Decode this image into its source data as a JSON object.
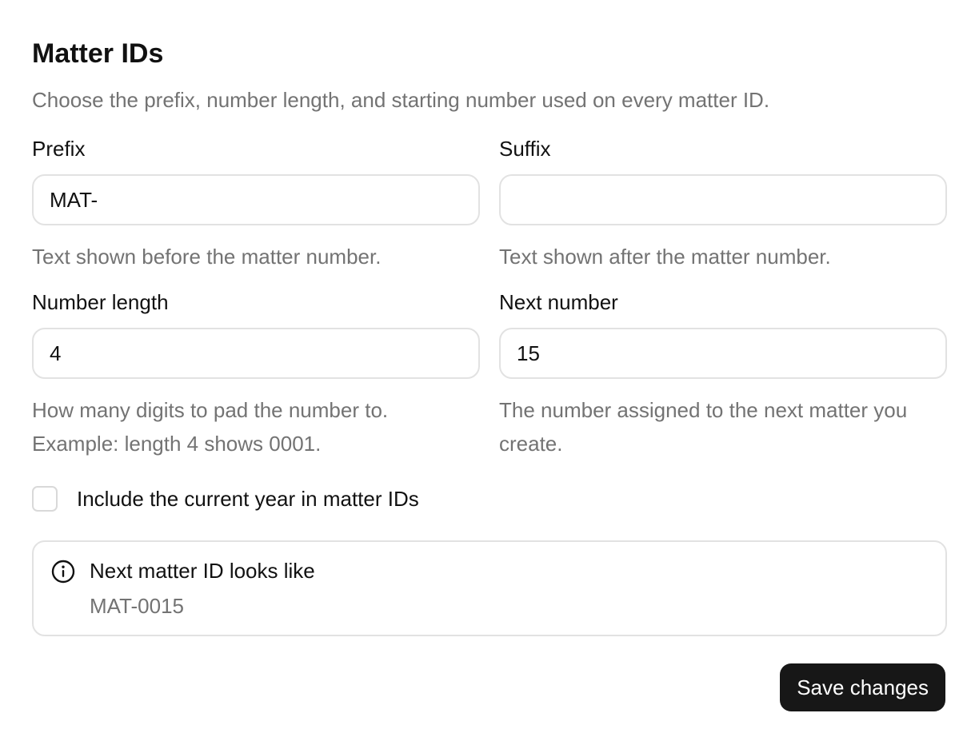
{
  "section": {
    "title": "Matter IDs",
    "description": "Choose the prefix, number length, and starting number used on every matter ID."
  },
  "fields": {
    "prefix": {
      "label": "Prefix",
      "value": "MAT-",
      "placeholder": "",
      "help": "Text shown before the matter number."
    },
    "suffix": {
      "label": "Suffix",
      "value": "",
      "placeholder": "",
      "help": "Text shown after the matter number."
    },
    "number_length": {
      "label": "Number length",
      "value": "4",
      "placeholder": "",
      "help": "How many digits to pad the number to. Example: length 4 shows 0001."
    },
    "next_number": {
      "label": "Next number",
      "value": "15",
      "placeholder": "",
      "help": "The number assigned to the next matter you create."
    }
  },
  "include_year": {
    "label": "Include the current year in matter IDs",
    "checked": false
  },
  "preview": {
    "icon": "info-icon",
    "title": "Next matter ID looks like",
    "value": "MAT-0015"
  },
  "actions": {
    "save_label": "Save changes"
  },
  "colors": {
    "primary_button": "#171717",
    "muted_text": "#737373",
    "border": "#e2e2e2"
  }
}
